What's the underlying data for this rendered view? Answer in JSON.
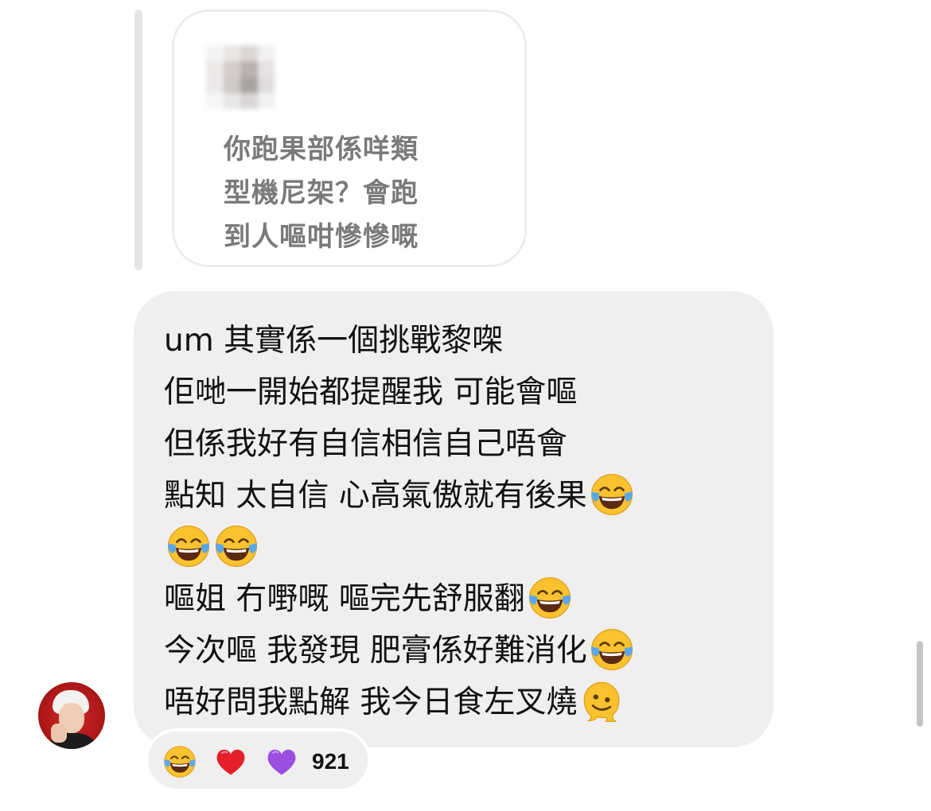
{
  "quoted_message": {
    "lines": [
      "你跑果部係咩類",
      "型機尼架？會跑",
      "到人嘔咁慘慘嘅"
    ],
    "thumbnail": "blurred-image"
  },
  "message": {
    "lines": [
      {
        "text": "um 其實係一個挑戰黎㗎",
        "emojis": []
      },
      {
        "text": "佢哋一開始都提醒我 可能會嘔",
        "emojis": []
      },
      {
        "text": "但係我好有自信相信自己唔會",
        "emojis": []
      },
      {
        "text": "點知 太自信 心高氣傲就有後果",
        "emojis": [
          "joy"
        ]
      },
      {
        "text": "",
        "emojis": [
          "joy",
          "joy"
        ]
      },
      {
        "text": "嘔姐 冇嘢嘅 嘔完先舒服翻",
        "emojis": [
          "joy"
        ]
      },
      {
        "text": "今次嘔 我發現 肥膏係好難消化",
        "emojis": [
          "joy"
        ]
      },
      {
        "text": "唔好問我點解 我今日食左叉燒",
        "emojis": [
          "melting-face"
        ]
      }
    ]
  },
  "reactions": {
    "emojis": [
      "joy",
      "red-heart",
      "purple-heart"
    ],
    "count": "921"
  },
  "colors": {
    "bubble_bg": "#efefef",
    "quote_text": "#7a7a7c",
    "text": "#111111",
    "avatar_bg": "#c41e1e"
  }
}
